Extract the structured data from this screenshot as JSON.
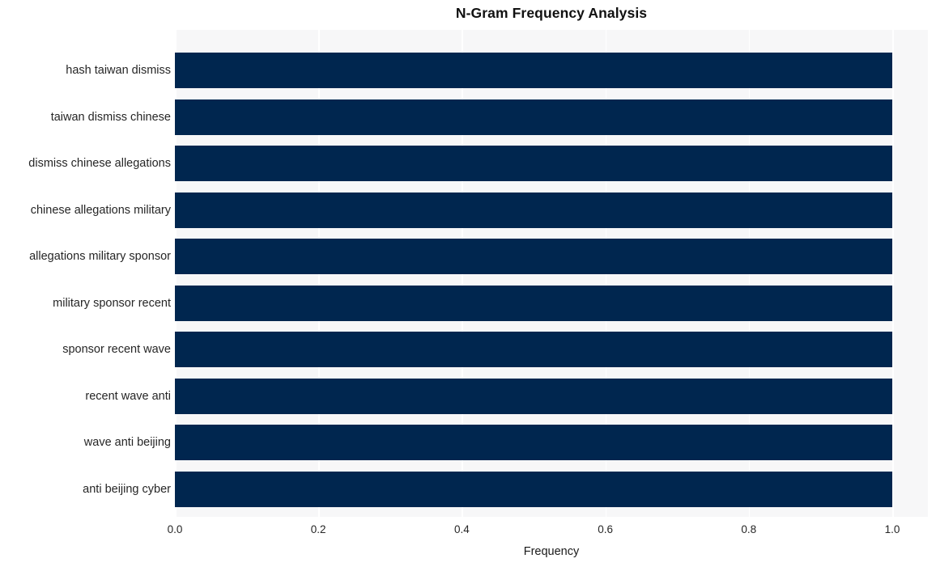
{
  "chart_data": {
    "type": "bar",
    "orientation": "horizontal",
    "title": "N-Gram Frequency Analysis",
    "xlabel": "Frequency",
    "ylabel": "",
    "categories": [
      "hash taiwan dismiss",
      "taiwan dismiss chinese",
      "dismiss chinese allegations",
      "chinese allegations military",
      "allegations military sponsor",
      "military sponsor recent",
      "sponsor recent wave",
      "recent wave anti",
      "wave anti beijing",
      "anti beijing cyber"
    ],
    "values": [
      1.0,
      1.0,
      1.0,
      1.0,
      1.0,
      1.0,
      1.0,
      1.0,
      1.0,
      1.0
    ],
    "xlim": [
      0.0,
      1.05
    ],
    "xticks": [
      0.0,
      0.2,
      0.4,
      0.6,
      0.8,
      1.0
    ],
    "xtick_labels": [
      "0.0",
      "0.2",
      "0.4",
      "0.6",
      "0.8",
      "1.0"
    ],
    "grid": true,
    "grid_axis": "x",
    "legend": false,
    "bar_color": "#00264f",
    "plot_background": "#f7f7f8",
    "figure_background": "#ffffff",
    "grid_color": "#ffffff"
  }
}
